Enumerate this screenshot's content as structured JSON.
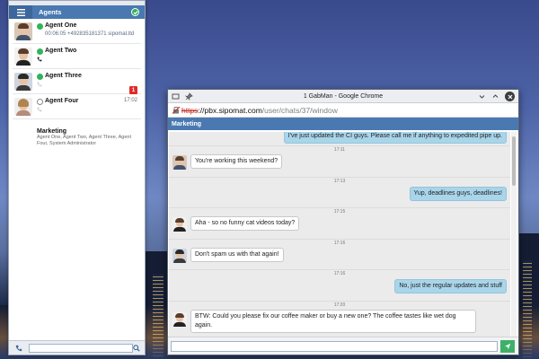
{
  "agents_panel": {
    "title": "Agents",
    "search_placeholder": "",
    "agents": [
      {
        "name": "Agent One",
        "status": "online",
        "detail": "00:06:05 +492835181371 sipomat.ltd",
        "time": "",
        "badge": ""
      },
      {
        "name": "Agent Two",
        "status": "online",
        "detail": "",
        "time": "",
        "badge": ""
      },
      {
        "name": "Agent Three",
        "status": "online",
        "detail": "",
        "time": "",
        "badge": "1"
      },
      {
        "name": "Agent Four",
        "status": "offline",
        "detail": "",
        "time": "17:02",
        "badge": ""
      }
    ],
    "group": {
      "name": "Marketing",
      "members": "Agent One, Agent Two, Agent Three, Agent Four, System Administrator"
    }
  },
  "browser": {
    "window_title": "1 GabMan - Google Chrome",
    "url_scheme": "https",
    "url_host": "://pbx.sipomat.com",
    "url_path": "/user/chats/37/window"
  },
  "chat": {
    "header": "Marketing",
    "composer_placeholder": "",
    "messages": [
      {
        "direction": "out",
        "time": "",
        "text": "I've just updated the CI guys. Please call me if anything to expedited pipe up."
      },
      {
        "direction": "in",
        "avatar": "a1",
        "time": "17:11",
        "text": "You're working this weekend?"
      },
      {
        "direction": "out",
        "time": "17:13",
        "text": "Yup, deadlines guys, deadlines!"
      },
      {
        "direction": "in",
        "avatar": "a2",
        "time": "17:15",
        "text": "Aha - so no funny cat videos today?"
      },
      {
        "direction": "in",
        "avatar": "a3",
        "time": "17:16",
        "text": "Don't spam us with that again!"
      },
      {
        "direction": "out",
        "time": "17:16",
        "text": "No, just the regular updates and stuff"
      },
      {
        "direction": "in",
        "avatar": "a2",
        "time": "17:20",
        "text": "BTW: Could you please fix our coffee maker or buy a new one? The coffee tastes like wet dog again."
      }
    ]
  },
  "colors": {
    "accent": "#4a79b1",
    "online": "#32b35a",
    "badge": "#e02b2b",
    "outgoing_bubble": "#a9d5ea",
    "send_button": "#3fb069"
  }
}
